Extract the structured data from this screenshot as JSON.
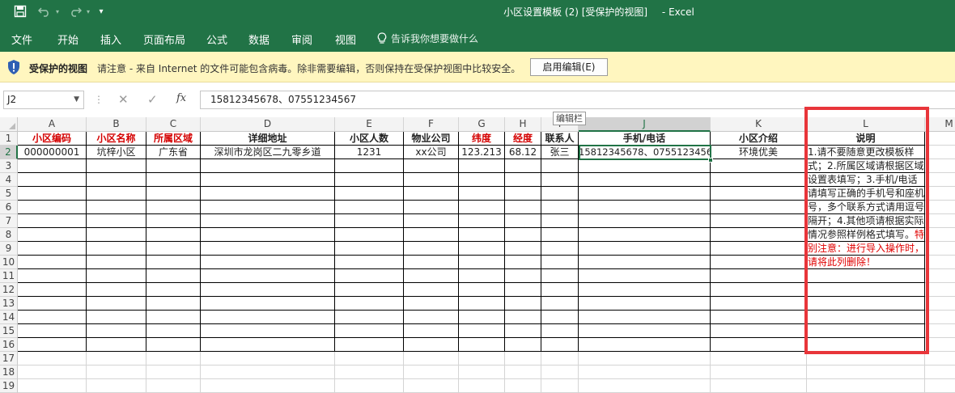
{
  "window": {
    "title": "小区设置模板 (2)  [受保护的视图]",
    "app_name": "Excel",
    "brand_color": "#217346"
  },
  "quick_access": {
    "icons": [
      "save-icon",
      "undo-icon",
      "redo-icon",
      "customize-icon"
    ]
  },
  "ribbon": {
    "tabs": [
      "文件",
      "开始",
      "插入",
      "页面布局",
      "公式",
      "数据",
      "审阅",
      "视图"
    ],
    "tell_me": "告诉我你想要做什么"
  },
  "protected_view": {
    "title": "受保护的视图",
    "message": "请注意 - 来自 Internet 的文件可能包含病毒。除非需要编辑，否则保持在受保护视图中比较安全。",
    "enable_button": "启用编辑(E)",
    "bar_color": "#fff6bf"
  },
  "formula_bar": {
    "name_box": "J2",
    "cancel": "✕",
    "enter": "✓",
    "fx": "fx",
    "formula": "15812345678、07551234567",
    "tooltip": "编辑栏"
  },
  "sheet": {
    "columns": [
      "A",
      "B",
      "C",
      "D",
      "E",
      "F",
      "G",
      "H",
      "I",
      "J",
      "K",
      "L",
      "M"
    ],
    "selected_column": "J",
    "row_numbers": [
      "1",
      "2",
      "3",
      "4",
      "5",
      "6",
      "7",
      "8",
      "9",
      "10",
      "11",
      "12",
      "13",
      "14",
      "15",
      "16",
      "17",
      "18",
      "19"
    ],
    "selected_row": "2",
    "headers": [
      "小区编码",
      "小区名称",
      "所属区域",
      "详细地址",
      "小区人数",
      "物业公司",
      "纬度",
      "经度",
      "联系人",
      "手机/电话",
      "小区介绍",
      "说明"
    ],
    "header_red": [
      true,
      true,
      true,
      false,
      false,
      false,
      true,
      true,
      false,
      false,
      false,
      false
    ],
    "row2": [
      "000000001",
      "坑梓小区",
      "广东省",
      "深圳市龙岗区二九零乡道",
      "1231",
      "xx公司",
      "123.213",
      "68.12",
      "张三",
      "15812345678、07551234567",
      "环境优美"
    ],
    "note_black": "1.请不要随意更改模板样式；2.所属区域请根据区域设置表填写；3.手机/电话请填写正确的手机号和座机号，多个联系方式请用逗号隔开；4.其他项请根据实际情况参照样例格式填写。",
    "note_red": "特别注意：进行导入操作时，请将此列删除！",
    "highlight_color": "#e8353a",
    "red_text_color": "#d40000"
  }
}
